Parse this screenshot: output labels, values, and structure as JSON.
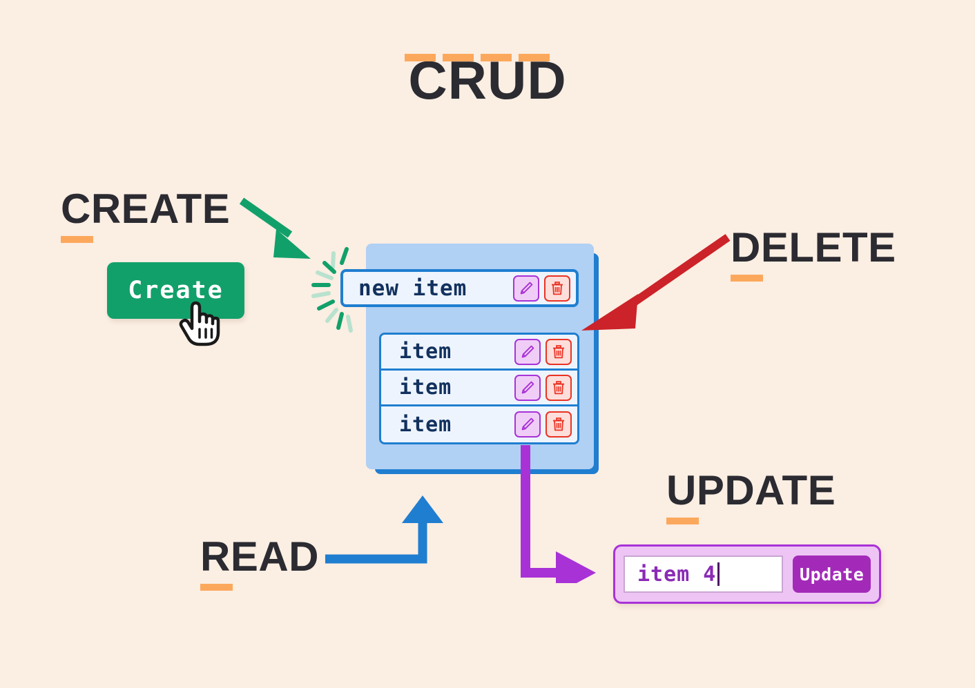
{
  "page": {
    "title": "CRUD",
    "background_color": "#fbeee3",
    "accent_underline_color": "#fca85c",
    "heading_color": "#2b2b31"
  },
  "labels": {
    "create": "CREATE",
    "read": "READ",
    "update": "UPDATE",
    "delete": "DELETE"
  },
  "create_section": {
    "button_label": "Create",
    "button_color": "#12a06a",
    "cursor_icon": "pointing-hand-cursor",
    "arrow_color": "#12a06a",
    "sparkle_color": "#12a06a"
  },
  "list_panel": {
    "panel_color": "#b0d0f4",
    "shadow_color": "#1f7ed0",
    "new_item": {
      "text": "new item",
      "edit_icon": "pencil-icon",
      "delete_icon": "trash-icon"
    },
    "items": [
      {
        "text": "item",
        "edit_icon": "pencil-icon",
        "delete_icon": "trash-icon"
      },
      {
        "text": "item",
        "edit_icon": "pencil-icon",
        "delete_icon": "trash-icon"
      },
      {
        "text": "item",
        "edit_icon": "pencil-icon",
        "delete_icon": "trash-icon"
      }
    ]
  },
  "read_section": {
    "arrow_color": "#1f7ed0"
  },
  "delete_section": {
    "arrow_color": "#cc2229"
  },
  "update_section": {
    "arrow_color": "#a832d6",
    "input_value": "item 4",
    "button_label": "Update",
    "panel_color": "#eec4f5",
    "button_color": "#a32ab8"
  }
}
